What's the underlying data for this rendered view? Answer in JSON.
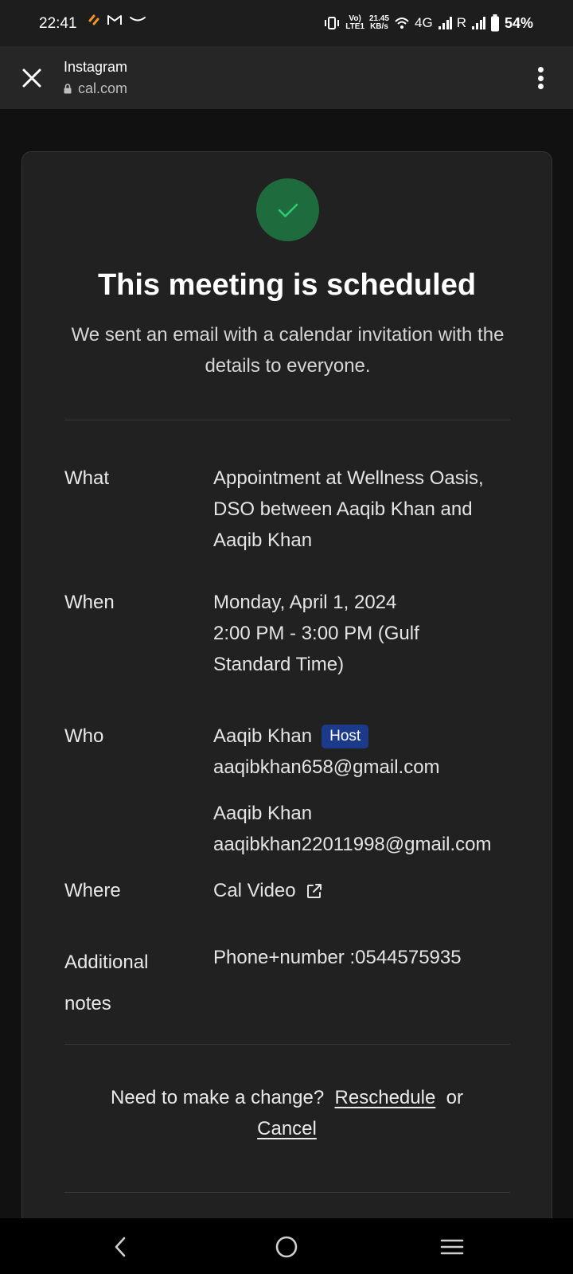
{
  "status_bar": {
    "time": "22:41",
    "net_speed_value": "21.45",
    "net_speed_unit": "KB/s",
    "volte_label": "Vo)",
    "lte_label": "LTE1",
    "network_type": "4G",
    "roaming_label": "R",
    "battery": "54%"
  },
  "browser": {
    "title": "Instagram",
    "url": "cal.com"
  },
  "booking": {
    "title": "This meeting is scheduled",
    "subtitle": "We sent an email with a calendar invitation with the details to everyone.",
    "what_label": "What",
    "what_value": "Appointment at Wellness Oasis, DSO between Aaqib Khan and Aaqib Khan",
    "when_label": "When",
    "when_date": "Monday, April 1, 2024",
    "when_time": "2:00 PM - 3:00 PM (Gulf Standard Time)",
    "who_label": "Who",
    "host_name": "Aaqib Khan",
    "host_badge": "Host",
    "host_email": "aaqibkhan658@gmail.com",
    "attendee_name": "Aaqib Khan",
    "attendee_email": "aaqibkhan22011998@gmail.com",
    "where_label": "Where",
    "where_value": "Cal Video",
    "notes_label": "Additional notes",
    "notes_value": "Phone+number :0544575935",
    "change_prompt": "Need to make a change?",
    "reschedule_link": "Reschedule",
    "or_text": "or",
    "cancel_link": "Cancel"
  },
  "icons": {
    "close": "close-icon",
    "lock": "lock-icon",
    "menu": "more-vertical-icon",
    "check": "check-icon",
    "external_link": "external-link-icon",
    "back": "back-icon",
    "home": "home-icon",
    "recents": "recents-icon"
  },
  "colors": {
    "success_circle": "#1e6b3d",
    "check": "#2ecc71",
    "host_badge": "#1c3a8a",
    "card": "#212121"
  }
}
